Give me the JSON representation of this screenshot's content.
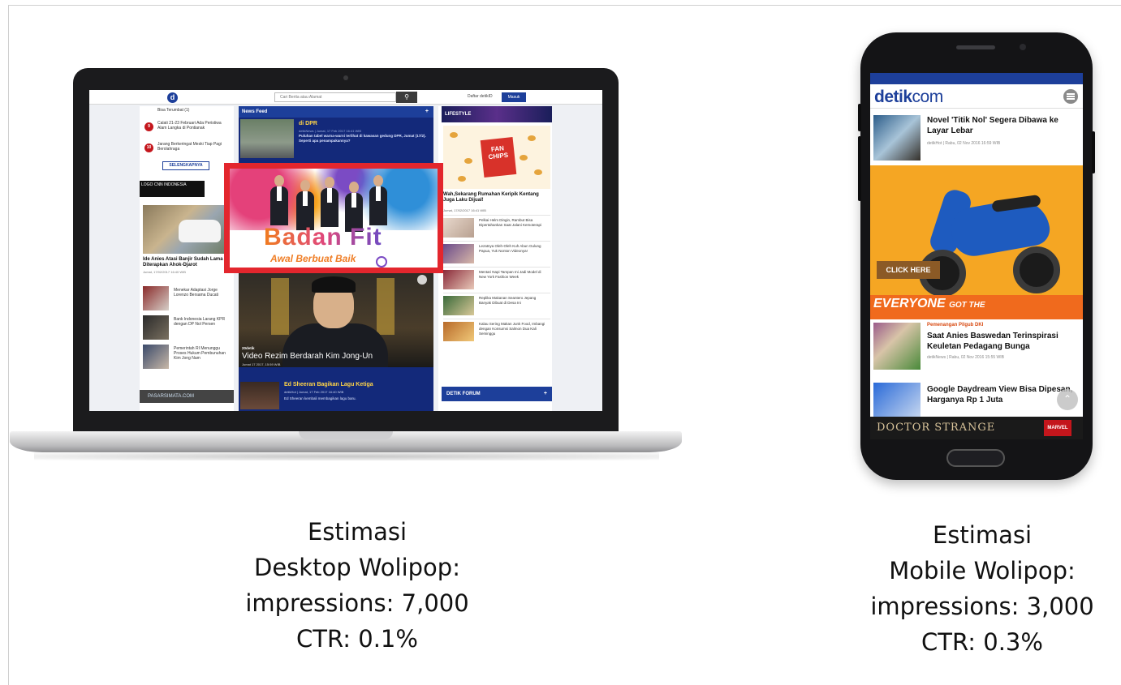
{
  "desktop_site": {
    "search_placeholder": "Cari Berita atau Alamat",
    "search_icon": "search-icon",
    "daftar_label": "Daftar detikID",
    "masuk_label": "Masuk",
    "left": {
      "top_text": "Bisa Terumbat (1)",
      "items": [
        {
          "num": "9",
          "text": "Calati 21-23 Februari Ada Peristiwa Alam Langka di Pontianak"
        },
        {
          "num": "10",
          "text": "Jarang Berkeringat Meski Tiap Pagi Berolahraga"
        }
      ],
      "selengkapnya": "SELENGKAPNYA",
      "blackbar_text": "LOGO CNN INDONESIA",
      "headline": "Ide Anies Atasi Banjir Sudah Lama Diterapkan Ahok-Djarot",
      "headline_meta": "Jumat, 17/02/2017 16:40 WIB",
      "list": [
        "Menekar Adaptasi Jorge Lorenzo Bersama Ducati",
        "Bank Indonesia Larang KPR dengan DP Nol Persen",
        "Pemerintah RI Menunggu Proses Hukum Pembunuhan Kim Jong Nam"
      ],
      "pasar_label": "PASARSIMATA.COM"
    },
    "mid": {
      "newsfeed_label": "News Feed",
      "plus": "+",
      "feed_title": "di DPR",
      "feed_meta": "detikNews | Jumat, 17 Feb 2017 16:41 WIB",
      "feed_text": "Puluhan tabel warna-warni terlihat di kawasan gedung DPR, Jumat (17/2). Seperti apa penampakannya?",
      "ad_title": "Badan Fit",
      "ad_sub": "Awal Berbuat Baik",
      "video_tag": "20detik",
      "video_title": "Video Rezim Berdarah Kim Jong-Un",
      "video_date": "Jumat 17 2017, 15:59 WIB",
      "ed_title": "Ed Sheeran Bagikan Lagu Ketiga",
      "ed_meta": "detikHot | Jumat, 17 Feb 2017 16:40 WIB",
      "ed_text": "Ed Sheeran kembali membagikan lagu baru."
    },
    "right": {
      "lifestyle_label": "LIFESTYLE",
      "chips_label": "FAN CHIPS",
      "title": "Wah,Sekarang Rumahan Keripik Kentang Juga Laku Dijual!",
      "meta": "Jumat, 17/02/2017 16:41 WIB",
      "items": [
        "Pelkai Helm Dingin, Rambut Bisa Dipertahankan Saat Jalani Kemoterapi",
        "Lezatnya Oleh-Oleh Kuh Abun Gulung Papua, Yuk Nonton Videonya!",
        "Mentari Napi Tampan Ini Jadi Model di New York Fashion Week",
        "Replika Makanan Seantero Jepang Banyak Dibuat di Desa Ini",
        "Kalau Sering Makan Junk Food, Imbangi dengan Konsumsi Salmon Dua Kali Seminggu"
      ],
      "forum_label": "DETIK FORUM"
    }
  },
  "mobile_site": {
    "logo_main": "detik",
    "logo_com": "com",
    "menu_icon": "hamburger-menu-icon",
    "row1_title": "Novel 'Titik Nol' Segera Dibawa ke Layar Lebar",
    "row1_meta": "detikHot | Rabu, 02 Nov 2016 16:59 WIB",
    "ad_click": "CLICK HERE",
    "ad_everyone": "EVERYONE",
    "ad_got": "GOT THE",
    "row2_kicker": "Pemenangan Pilgub DKI",
    "row2_title": "Saat Anies Baswedan Terinspirasi Keuletan Pedagang Bunga",
    "row2_meta": "detikNews | Rabu, 02 Nov 2016 15:55 WIB",
    "row3_title": "Google Daydream View Bisa Dipesan, Harganya Rp 1 Juta",
    "up_icon": "scroll-top-icon",
    "bottom_ad_title": "DOCTOR STRANGE",
    "bottom_ad_brand": "MARVEL"
  },
  "captions": {
    "desktop": {
      "line1": "Estimasi",
      "line2": "Desktop Wolipop:",
      "line3": "impressions: 7,000",
      "line4": "CTR: 0.1%"
    },
    "mobile": {
      "line1": "Estimasi",
      "line2": "Mobile Wolipop:",
      "line3": "impressions: 3,000",
      "line4": "CTR: 0.3%"
    }
  },
  "colors": {
    "ad_highlight": "#e3262d",
    "detik_blue": "#1d3f9a",
    "ad_orange": "#f5a623"
  }
}
